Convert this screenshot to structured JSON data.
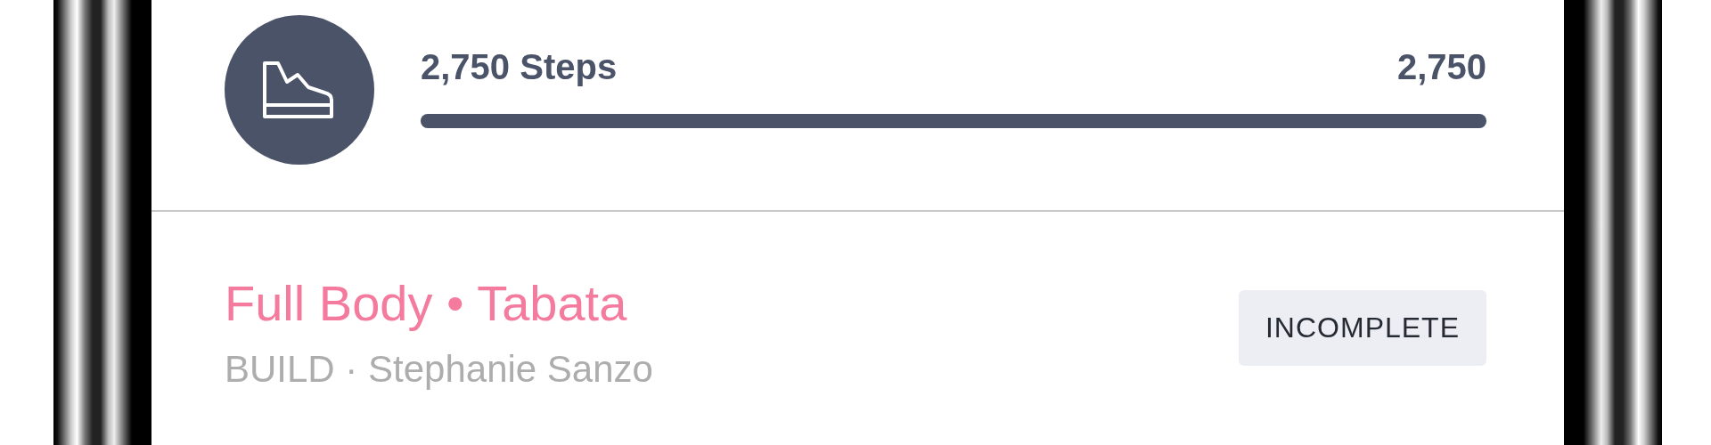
{
  "steps": {
    "label": "2,750 Steps",
    "value": "2,750",
    "level": 1
  },
  "workout": {
    "title": "Full Body • Tabata",
    "subtitle": "BUILD · Stephanie Sanzo",
    "status": "INCOMPLETE"
  }
}
